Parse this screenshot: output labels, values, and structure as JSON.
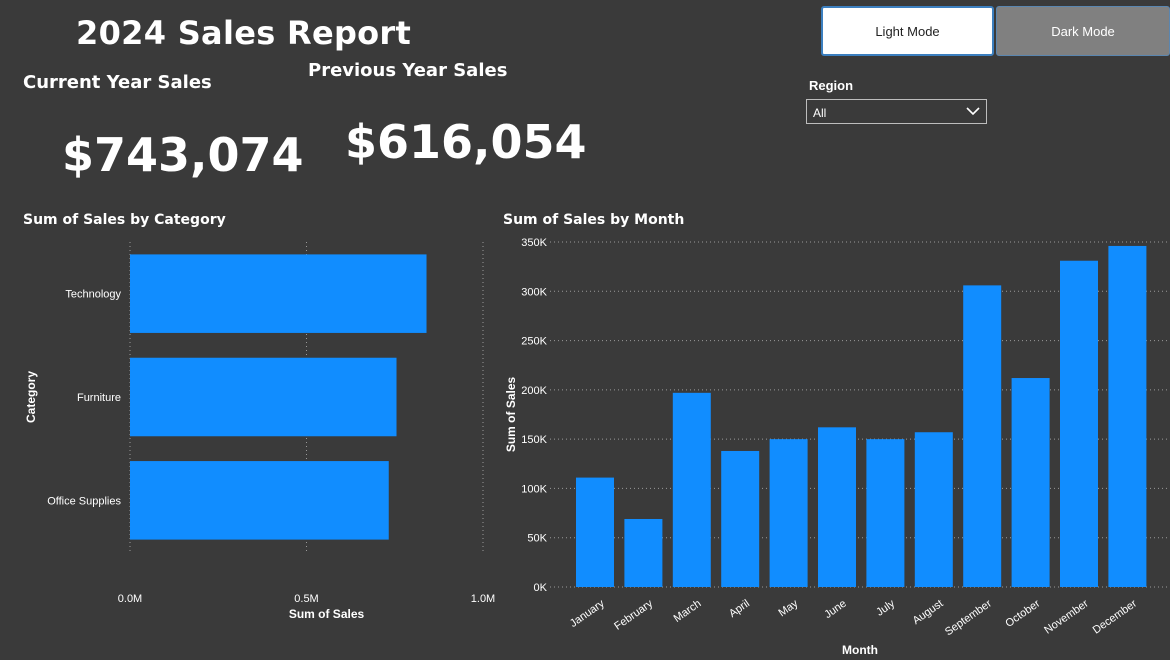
{
  "header": {
    "title": "2024 Sales Report"
  },
  "kpis": {
    "current": {
      "label": "Current Year Sales",
      "value": "$743,074"
    },
    "previous": {
      "label": "Previous Year Sales",
      "value": "$616,054"
    }
  },
  "buttons": {
    "light": "Light Mode",
    "dark": "Dark Mode"
  },
  "filter": {
    "label": "Region",
    "value": "All"
  },
  "colors": {
    "background": "#3a3a3a",
    "bar": "#118dff",
    "text": "#ffffff"
  },
  "chart_data": [
    {
      "type": "bar",
      "orientation": "horizontal",
      "title": "Sum of Sales by Category",
      "categories": [
        "Technology",
        "Furniture",
        "Office Supplies"
      ],
      "values": [
        840000,
        755000,
        733000
      ],
      "xlabel": "Sum of Sales",
      "ylabel": "Category",
      "xlim": [
        0,
        1000000
      ],
      "ticks": [
        0,
        500000,
        1000000
      ],
      "tick_labels": [
        "0.0M",
        "0.5M",
        "1.0M"
      ],
      "grid": true
    },
    {
      "type": "bar",
      "orientation": "vertical",
      "title": "Sum of Sales by Month",
      "categories": [
        "January",
        "February",
        "March",
        "April",
        "May",
        "June",
        "July",
        "August",
        "September",
        "October",
        "November",
        "December"
      ],
      "values": [
        111000,
        69000,
        197000,
        138000,
        150000,
        162000,
        150000,
        157000,
        306000,
        212000,
        331000,
        346000
      ],
      "xlabel": "Month",
      "ylabel": "Sum of Sales",
      "ylim": [
        0,
        350000
      ],
      "ticks": [
        0,
        50000,
        100000,
        150000,
        200000,
        250000,
        300000,
        350000
      ],
      "tick_labels": [
        "0K",
        "50K",
        "100K",
        "150K",
        "200K",
        "250K",
        "300K",
        "350K"
      ],
      "grid": true
    }
  ]
}
